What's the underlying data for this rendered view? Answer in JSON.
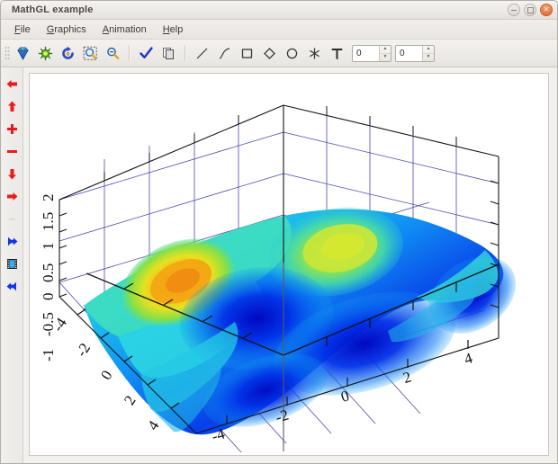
{
  "window": {
    "title": "MathGL example",
    "controls": [
      {
        "name": "minimize-button",
        "glyph": "–"
      },
      {
        "name": "maximize-button",
        "glyph": "□"
      },
      {
        "name": "close-button",
        "glyph": "×"
      }
    ]
  },
  "menubar": {
    "items": [
      {
        "label": "File",
        "mnemonic": "F",
        "rest": "ile"
      },
      {
        "label": "Graphics",
        "mnemonic": "G",
        "rest": "raphics"
      },
      {
        "label": "Animation",
        "mnemonic": "A",
        "rest": "nimation"
      },
      {
        "label": "Help",
        "mnemonic": "H",
        "rest": "elp"
      }
    ]
  },
  "toolbar": {
    "buttons": [
      {
        "name": "alpha-gem-icon",
        "tip": "Toggle transparency"
      },
      {
        "name": "light-bulb-icon",
        "tip": "Toggle lighting"
      },
      {
        "name": "rotate-reset-icon",
        "tip": "Restore default view"
      },
      {
        "name": "zoom-region-icon",
        "tip": "Zoom into region"
      },
      {
        "name": "zoom-out-icon",
        "tip": "Zoom out"
      },
      {
        "name": "check-mark-icon",
        "tip": "Accept"
      },
      {
        "name": "copy-icon",
        "tip": "Copy graphics"
      },
      {
        "name": "line-tool-icon",
        "tip": "Draw line"
      },
      {
        "name": "curve-tool-icon",
        "tip": "Draw curve"
      },
      {
        "name": "rect-tool-icon",
        "tip": "Draw rectangle"
      },
      {
        "name": "rhomb-tool-icon",
        "tip": "Draw rhombus"
      },
      {
        "name": "ellipse-tool-icon",
        "tip": "Draw ellipse"
      },
      {
        "name": "mark-tool-icon",
        "tip": "Draw marker"
      },
      {
        "name": "text-tool-icon",
        "tip": "Add text"
      }
    ],
    "spin_left": {
      "value": "0",
      "placeholder": "0"
    },
    "spin_right": {
      "value": "0",
      "placeholder": "0"
    }
  },
  "sidebar": {
    "buttons": [
      {
        "name": "arrow-left-icon",
        "color": "#e02020",
        "dir": "left"
      },
      {
        "name": "arrow-up-icon",
        "color": "#e02020",
        "dir": "up"
      },
      {
        "name": "plus-icon",
        "color": "#e02020",
        "dir": "plus"
      },
      {
        "name": "minus-icon",
        "color": "#e02020",
        "dir": "minus"
      },
      {
        "name": "arrow-down-icon",
        "color": "#e02020",
        "dir": "down"
      },
      {
        "name": "arrow-right-icon",
        "color": "#e02020",
        "dir": "right"
      },
      {
        "name": "separator",
        "color": "#cfcac3",
        "dir": "sep"
      },
      {
        "name": "arrow-right-blue-icon",
        "color": "#1030f0",
        "dir": "right"
      },
      {
        "name": "film-strip-icon",
        "color": "#2f6fd0",
        "dir": "film"
      },
      {
        "name": "arrow-left-blue-icon",
        "color": "#1030f0",
        "dir": "left"
      }
    ]
  },
  "chart_data": {
    "type": "surface",
    "title": "",
    "xlabel": "",
    "ylabel": "",
    "zlabel": "",
    "xlim": [
      -5,
      5
    ],
    "ylim": [
      -5,
      5
    ],
    "zlim": [
      -1,
      2
    ],
    "x_ticks": [
      "-4",
      "-2",
      "0",
      "2",
      "4"
    ],
    "y_ticks": [
      "-4",
      "-2",
      "0",
      "2",
      "4"
    ],
    "z_ticks": [
      "2",
      "1.5",
      "1",
      "0.5",
      "0",
      "-0.5",
      "-1"
    ],
    "colormap": "jet",
    "colormap_stops": [
      "#0000b0",
      "#0040ff",
      "#00b0ff",
      "#30e0c0",
      "#70e060",
      "#c8e040",
      "#f8c020",
      "#f07818"
    ],
    "grid": true,
    "grid_color": "#4040b0",
    "axis_color": "#101010",
    "legend": [],
    "surface_description": "MathGL sample 2D surface (surf of hat/ripple function) over x,y in [-5,5], z in [-1,2]; one orange-yellow peak in the left-back region, a yellow-green ridge in the back-right, deep blue valleys in the mid and front-right.",
    "peaks": [
      {
        "x": -3.2,
        "y": 2.4,
        "z": 1.35,
        "color": "#f08a10"
      },
      {
        "x": 0.6,
        "y": 3.2,
        "z": 1.05,
        "color": "#b9e048"
      },
      {
        "x": 3.4,
        "y": -0.2,
        "z": 0.35,
        "color": "#30d8d0"
      }
    ],
    "valleys": [
      {
        "x": -0.6,
        "y": -0.4,
        "z": -0.85,
        "color": "#0010c8"
      },
      {
        "x": 2.6,
        "y": -2.6,
        "z": -0.95,
        "color": "#0018d8"
      },
      {
        "x": 4.6,
        "y": -4.0,
        "z": -1.0,
        "color": "#0000a8"
      }
    ]
  }
}
